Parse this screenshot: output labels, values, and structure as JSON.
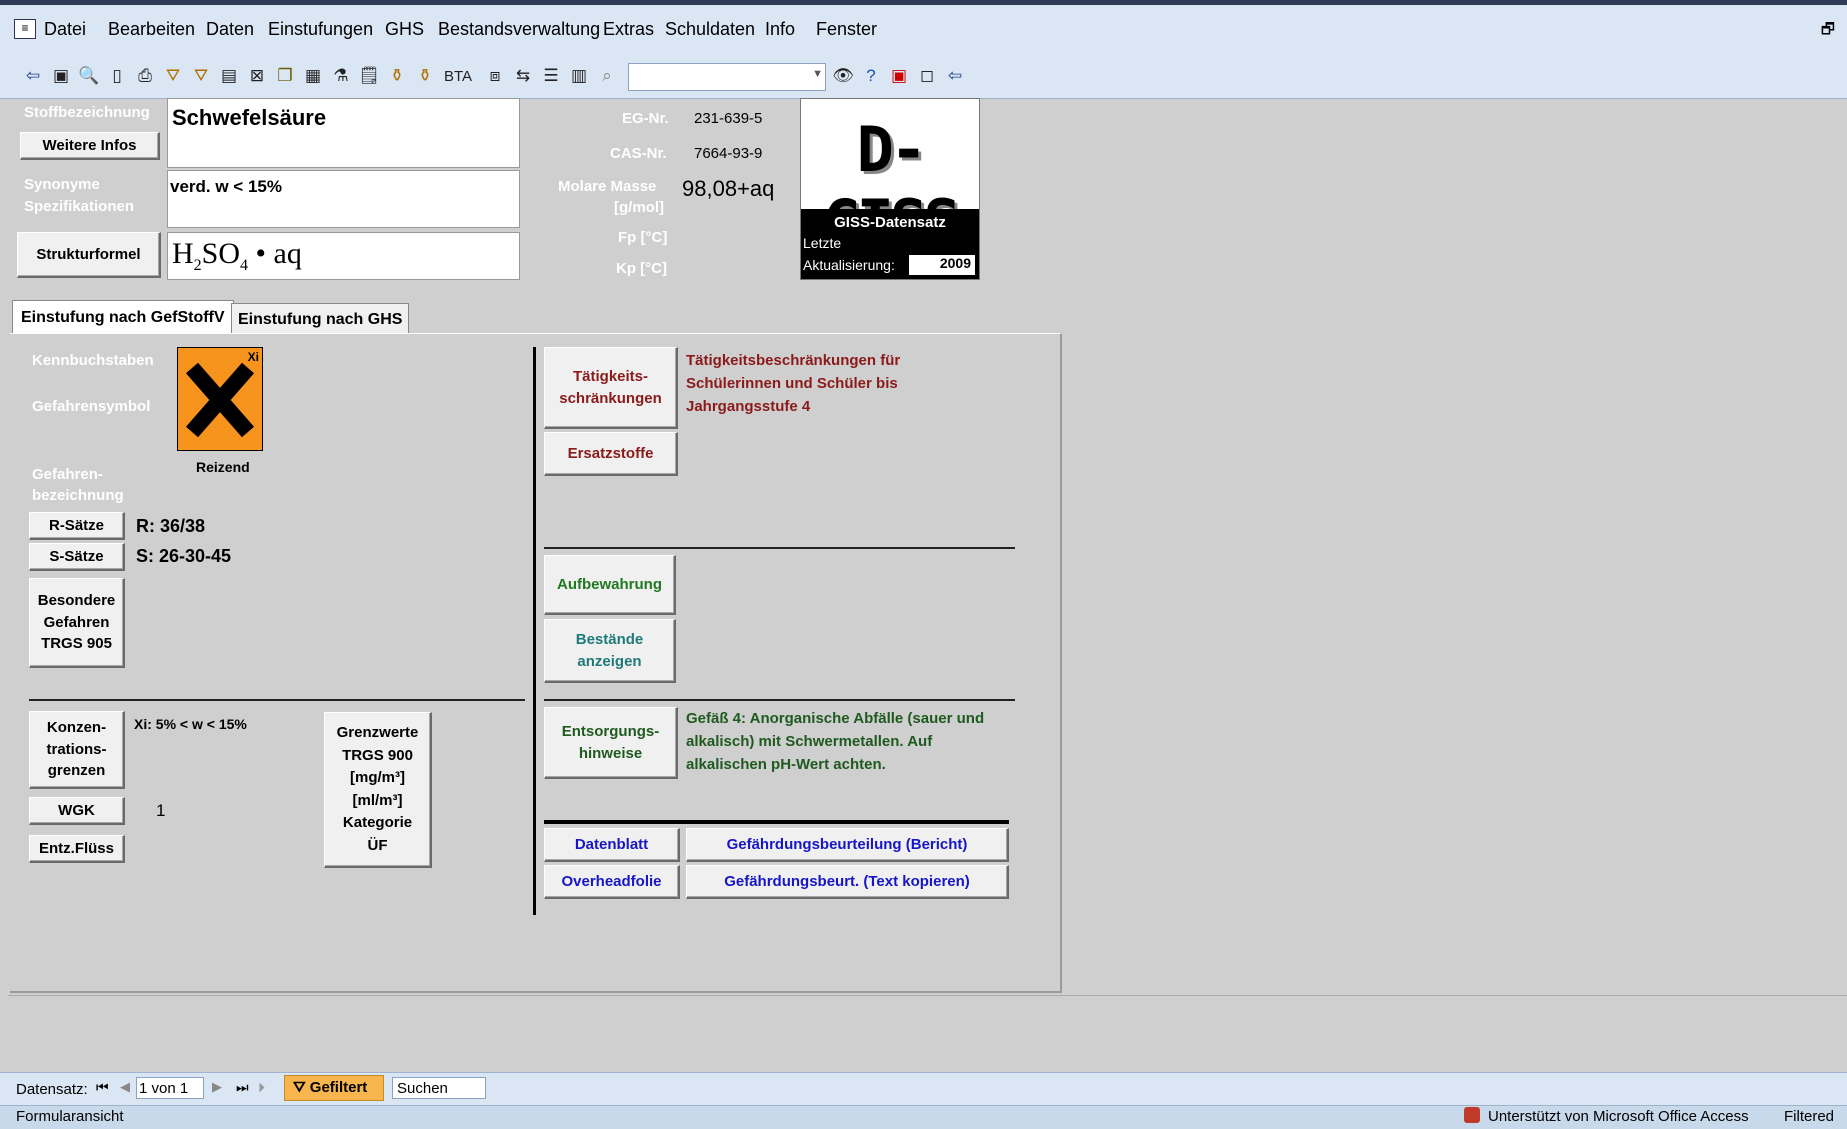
{
  "menu": [
    "Datei",
    "Bearbeiten",
    "Daten",
    "Einstufungen",
    "GHS",
    "Bestandsverwaltung",
    "Extras",
    "Schuldaten",
    "Info",
    "Fenster"
  ],
  "toolbar": {
    "bta_label": "BTA"
  },
  "header": {
    "stoff_label": "Stoffbezeichnung",
    "stoff_value": "Schwefelsäure",
    "weitere_infos": "Weitere Infos",
    "synonyme_label": "Synonyme",
    "spezifikationen_label": "Spezifikationen",
    "synonyme_value": "verd. w < 15%",
    "strukturformel_btn": "Strukturformel",
    "eg_label": "EG-Nr.",
    "eg_value": "231-639-5",
    "cas_label": "CAS-Nr.",
    "cas_value": "7664-93-9",
    "molare_label": "Molare Masse",
    "molare_unit": "[g/mol]",
    "molare_value": "98,08+aq",
    "fp_label": "Fp [°C]",
    "kp_label": "Kp [°C]",
    "logo_text": "D-GISS",
    "logo_caption": "GISS-Datensatz",
    "letzte": "Letzte",
    "aktualisierung": "Aktualisierung:",
    "aktualisierung_value": "2009"
  },
  "tabs": [
    "Einstufung nach GefStoffV",
    "Einstufung nach GHS"
  ],
  "left": {
    "kennbuchstaben": "Kennbuchstaben",
    "gefahrensymbol": "Gefahrensymbol",
    "symbol_caption": "Reizend",
    "symbol_code": "Xi",
    "gefahren_label1": "Gefahren-",
    "gefahren_label2": "bezeichnung",
    "r_btn": "R-Sätze",
    "r_value": "R: 36/38",
    "s_btn": "S-Sätze",
    "s_value": "S: 26-30-45",
    "besondere1": "Besondere",
    "besondere2": "Gefahren",
    "besondere3": "TRGS 905",
    "konz1": "Konzen-",
    "konz2": "trations-",
    "konz3": "grenzen",
    "konz_value": "Xi: 5% < w < 15%",
    "wgk_btn": "WGK",
    "wgk_value": "1",
    "entz_btn": "Entz.Flüss",
    "grenz1": "Grenzwerte",
    "grenz2": "TRGS 900",
    "grenz3": "[mg/m³]",
    "grenz4": "[ml/m³]",
    "grenz5": "Kategorie",
    "grenz6": "ÜF"
  },
  "right": {
    "taetig1": "Tätigkeits-",
    "taetig2": "schränkungen",
    "taetig_text1": "Tätigkeitsbeschränkungen für",
    "taetig_text2": "Schülerinnen und Schüler bis",
    "taetig_text3": "Jahrgangsstufe 4",
    "ersatz": "Ersatzstoffe",
    "aufbewahrung": "Aufbewahrung",
    "bestaende1": "Bestände",
    "bestaende2": "anzeigen",
    "entsorg1": "Entsorgungs-",
    "entsorg2": "hinweise",
    "entsorg_text1": "Gefäß 4: Anorganische Abfälle (sauer und",
    "entsorg_text2": "alkalisch) mit Schwermetallen. Auf",
    "entsorg_text3": "alkalischen pH-Wert achten.",
    "datenblatt": "Datenblatt",
    "overheadfolie": "Overheadfolie",
    "gefbericht": "Gefährdungsbeurteilung (Bericht)",
    "gefkopieren": "Gefährdungsbeurt. (Text kopieren)"
  },
  "status": {
    "datensatz": "Datensatz:",
    "record": "1 von 1",
    "gefiltert": "Gefiltert",
    "suchen": "Suchen",
    "formularansicht": "Formularansicht",
    "office": "Unterstützt von Microsoft Office Access",
    "filtered": "Filtered"
  }
}
